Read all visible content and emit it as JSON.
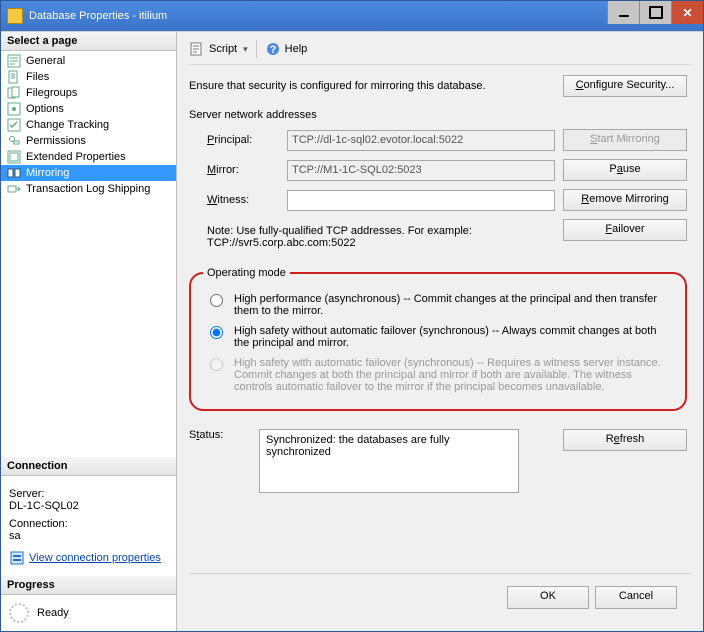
{
  "window": {
    "title": "Database Properties - itilium"
  },
  "left": {
    "select_page": "Select a page",
    "pages": [
      "General",
      "Files",
      "Filegroups",
      "Options",
      "Change Tracking",
      "Permissions",
      "Extended Properties",
      "Mirroring",
      "Transaction Log Shipping"
    ],
    "connection_hdr": "Connection",
    "server_lbl": "Server:",
    "server_val": "DL-1C-SQL02",
    "connection_lbl": "Connection:",
    "connection_val": "sa",
    "view_props": "View connection properties",
    "progress_hdr": "Progress",
    "progress_val": "Ready"
  },
  "toolbar": {
    "script": "Script",
    "help": "Help"
  },
  "main": {
    "ensure": "Ensure that security is configured for mirroring this database.",
    "config_sec": "Configure Security...",
    "net_hdr": "Server network addresses",
    "principal_lbl": "Principal:",
    "principal_val": "TCP://dl-1c-sql02.evotor.local:5022",
    "mirror_lbl": "Mirror:",
    "mirror_val": "TCP://M1-1C-SQL02:5023",
    "witness_lbl": "Witness:",
    "witness_val": "",
    "start_mirror": "Start Mirroring",
    "pause": "Pause",
    "remove": "Remove Mirroring",
    "failover": "Failover",
    "note": "Note: Use fully-qualified TCP addresses. For example: TCP://svr5.corp.abc.com:5022",
    "opmode_hdr": "Operating mode",
    "op1": "High performance (asynchronous) -- Commit changes at the principal and then transfer them to the mirror.",
    "op2": "High safety without automatic failover (synchronous) -- Always commit changes at both the principal and mirror.",
    "op3": "High safety with automatic failover (synchronous) -- Requires a witness server instance. Commit changes at both the principal and mirror if both are available. The witness controls automatic failover to the mirror if the principal becomes unavailable.",
    "status_lbl": "Status:",
    "status_val": "Synchronized: the databases are fully synchronized",
    "refresh": "Refresh"
  },
  "buttons": {
    "ok": "OK",
    "cancel": "Cancel"
  }
}
